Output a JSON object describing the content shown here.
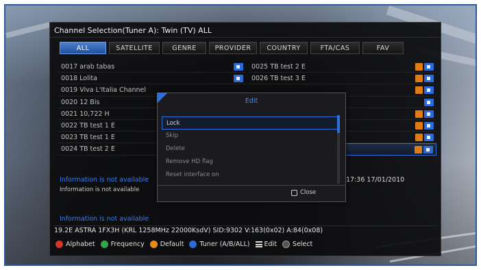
{
  "window": {
    "title": "Channel Selection(Tuner A): Twin (TV) ALL"
  },
  "tabs": [
    {
      "label": "ALL"
    },
    {
      "label": "SATELLITE"
    },
    {
      "label": "GENRE"
    },
    {
      "label": "PROVIDER"
    },
    {
      "label": "COUNTRY"
    },
    {
      "label": "FTA/CAS"
    },
    {
      "label": "FAV"
    }
  ],
  "left_channels": [
    {
      "label": "0017 arab tabas",
      "badges": [
        "tv"
      ]
    },
    {
      "label": "0018 Lolita",
      "badges": [
        "tv"
      ]
    },
    {
      "label": "0019 Viva L'Italia Channel",
      "badges": []
    },
    {
      "label": "0020 12 Bis",
      "badges": []
    },
    {
      "label": "0021 10,722 H",
      "badges": []
    },
    {
      "label": "0022 TB test 1 E",
      "badges": []
    },
    {
      "label": "0023 TB test 1 E",
      "badges": []
    },
    {
      "label": "0024 TB test 2 E",
      "badges": []
    }
  ],
  "right_channels": [
    {
      "label": "0025 TB test 2 E",
      "badges": [
        "lock",
        "tv"
      ]
    },
    {
      "label": "0026 TB test 3 E",
      "badges": [
        "lock",
        "tv"
      ]
    },
    {
      "label": "",
      "badges": [
        "lock",
        "tv"
      ]
    },
    {
      "label": "",
      "badges": [
        "tv"
      ]
    },
    {
      "label": "",
      "badges": [
        "lock",
        "tv"
      ]
    },
    {
      "label": "",
      "badges": [
        "lock",
        "tv"
      ]
    },
    {
      "label": "",
      "badges": [
        "lock",
        "tv"
      ]
    },
    {
      "label": "",
      "badges": [
        "lock",
        "tv"
      ]
    }
  ],
  "info": {
    "top_blue": "Information is not available",
    "top_white": "Information is not available",
    "bottom_blue": "Information is not available",
    "datetime": "17:36 17/01/2010",
    "tech_line": "19.2E  ASTRA 1FX3H (KRL 1258MHz 22000KsdV) SID:9302 V:163(0x02) A:84(0x08)"
  },
  "legend": [
    {
      "label": "Alphabet",
      "color": "#d8352a"
    },
    {
      "label": "Frequency",
      "color": "#2fa84a"
    },
    {
      "label": "Default",
      "color": "#e88a14"
    },
    {
      "label": "Tuner (A/B/ALL)",
      "color": "#2d6ad6"
    },
    {
      "label": "Edit",
      "icon": "menu-icon"
    },
    {
      "label": "Select",
      "icon": "ok-icon"
    }
  ],
  "popup": {
    "title": "Edit",
    "items": [
      "Lock",
      "Skip",
      "Delete",
      "Remove HD flag",
      "Reset interface on"
    ],
    "selected_index": 0,
    "close_label": "Close"
  },
  "colors": {
    "accent": "#2f6fd8",
    "info_blue": "#3c7df0",
    "lock_badge": "#e07a12",
    "tv_badge": "#2d6ad6"
  }
}
